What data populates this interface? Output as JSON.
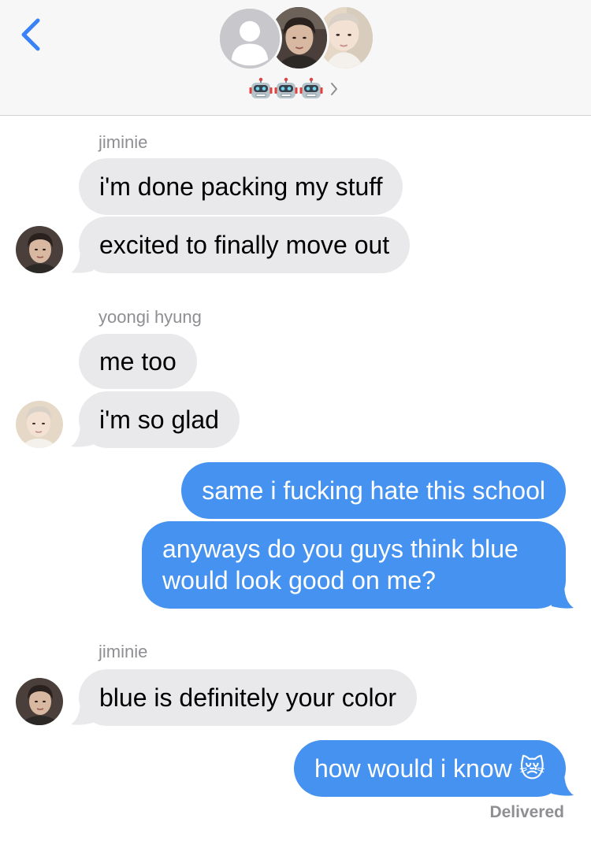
{
  "header": {
    "group_members": [
      "generic",
      "jiminie",
      "yoongi hyung"
    ],
    "group_emojis": [
      "🤖",
      "🤖",
      "🤖"
    ],
    "chevron": "›"
  },
  "messages": [
    {
      "sender": "jiminie",
      "direction": "incoming",
      "text": "i'm done packing my stuff"
    },
    {
      "sender": "jiminie",
      "direction": "incoming",
      "text": "excited to finally move out"
    },
    {
      "sender": "yoongi hyung",
      "direction": "incoming",
      "text": "me too"
    },
    {
      "sender": "yoongi hyung",
      "direction": "incoming",
      "text": "i'm so glad"
    },
    {
      "sender": "me",
      "direction": "outgoing",
      "text": "same i fucking hate this school"
    },
    {
      "sender": "me",
      "direction": "outgoing",
      "text": "anyways do you guys think blue would look good on me?"
    },
    {
      "sender": "jiminie",
      "direction": "incoming",
      "text": "blue is definitely your color"
    },
    {
      "sender": "me",
      "direction": "outgoing",
      "text": "how would i know 😿"
    }
  ],
  "senders": {
    "jiminie": "jiminie",
    "yoongi": "yoongi hyung"
  },
  "status": "Delivered",
  "colors": {
    "outgoing_bubble": "#4592f0",
    "incoming_bubble": "#e9e9eb",
    "accent": "#3a82f7",
    "meta_text": "#8e8e93"
  },
  "icons": [
    "chevron-left-icon",
    "robot-emoji-icon",
    "chevron-right-icon",
    "crying-cat-emoji-icon"
  ]
}
